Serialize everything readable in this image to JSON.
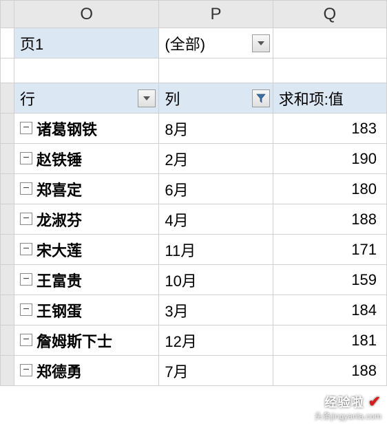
{
  "columns": {
    "o": "O",
    "p": "P",
    "q": "Q"
  },
  "pageFilter": {
    "label": "页1",
    "value": "(全部)"
  },
  "headers": {
    "row": "行",
    "col": "列",
    "sum": "求和项:值"
  },
  "rows": [
    {
      "name": "诸葛钢铁",
      "month": "8月",
      "value": 183
    },
    {
      "name": "赵铁锤",
      "month": "2月",
      "value": 190
    },
    {
      "name": "郑喜定",
      "month": "6月",
      "value": 180
    },
    {
      "name": "龙淑芬",
      "month": "4月",
      "value": 188
    },
    {
      "name": "宋大莲",
      "month": "11月",
      "value": 171
    },
    {
      "name": "王富贵",
      "month": "10月",
      "value": 159
    },
    {
      "name": "王钢蛋",
      "month": "3月",
      "value": 184
    },
    {
      "name": "詹姆斯下士",
      "month": "12月",
      "value": 181
    },
    {
      "name": "郑德勇",
      "month": "7月",
      "value": 188
    }
  ],
  "icons": {
    "collapse": "−"
  },
  "watermark": {
    "line1": "经验啦",
    "line2": "头条jingyanla.com"
  },
  "chart_data": {
    "type": "table",
    "title": "求和项:值",
    "columns": [
      "行",
      "列",
      "求和项:值"
    ],
    "data": [
      [
        "诸葛钢铁",
        "8月",
        183
      ],
      [
        "赵铁锤",
        "2月",
        190
      ],
      [
        "郑喜定",
        "6月",
        180
      ],
      [
        "龙淑芬",
        "4月",
        188
      ],
      [
        "宋大莲",
        "11月",
        171
      ],
      [
        "王富贵",
        "10月",
        159
      ],
      [
        "王钢蛋",
        "3月",
        184
      ],
      [
        "詹姆斯下士",
        "12月",
        181
      ],
      [
        "郑德勇",
        "7月",
        188
      ]
    ]
  }
}
